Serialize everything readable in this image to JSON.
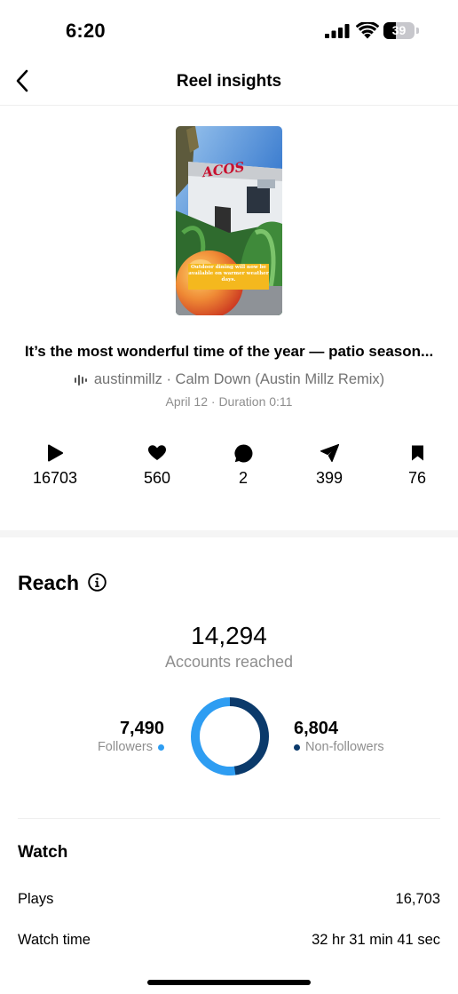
{
  "status_bar": {
    "time": "6:20",
    "battery_level": "39",
    "battery_fraction": 0.39
  },
  "header": {
    "title": "Reel insights"
  },
  "reel": {
    "thumbnail_caption": "Outdoor dining will now be available on warmer weather days.",
    "thumbnail_sign_text": "ACOS",
    "title": "It’s the most wonderful time of the year — patio season...",
    "audio": "austinmillz · Calm Down (Austin Millz Remix)",
    "meta": "April 12 · Duration 0:11"
  },
  "stats": [
    {
      "icon": "play-icon",
      "value": "16703"
    },
    {
      "icon": "heart-icon",
      "value": "560"
    },
    {
      "icon": "comment-icon",
      "value": "2"
    },
    {
      "icon": "share-icon",
      "value": "399"
    },
    {
      "icon": "bookmark-icon",
      "value": "76"
    }
  ],
  "reach": {
    "title": "Reach",
    "accounts_reached": "14,294",
    "accounts_label": "Accounts reached",
    "followers": {
      "value": "7,490",
      "label": "Followers",
      "count": 7490,
      "color": "#2e9df2"
    },
    "non_followers": {
      "value": "6,804",
      "label": "Non-followers",
      "count": 6804,
      "color": "#0b3a6b"
    }
  },
  "watch": {
    "title": "Watch",
    "rows": [
      {
        "label": "Plays",
        "value": "16,703"
      },
      {
        "label": "Watch time",
        "value": "32 hr 31 min 41 sec"
      }
    ]
  }
}
